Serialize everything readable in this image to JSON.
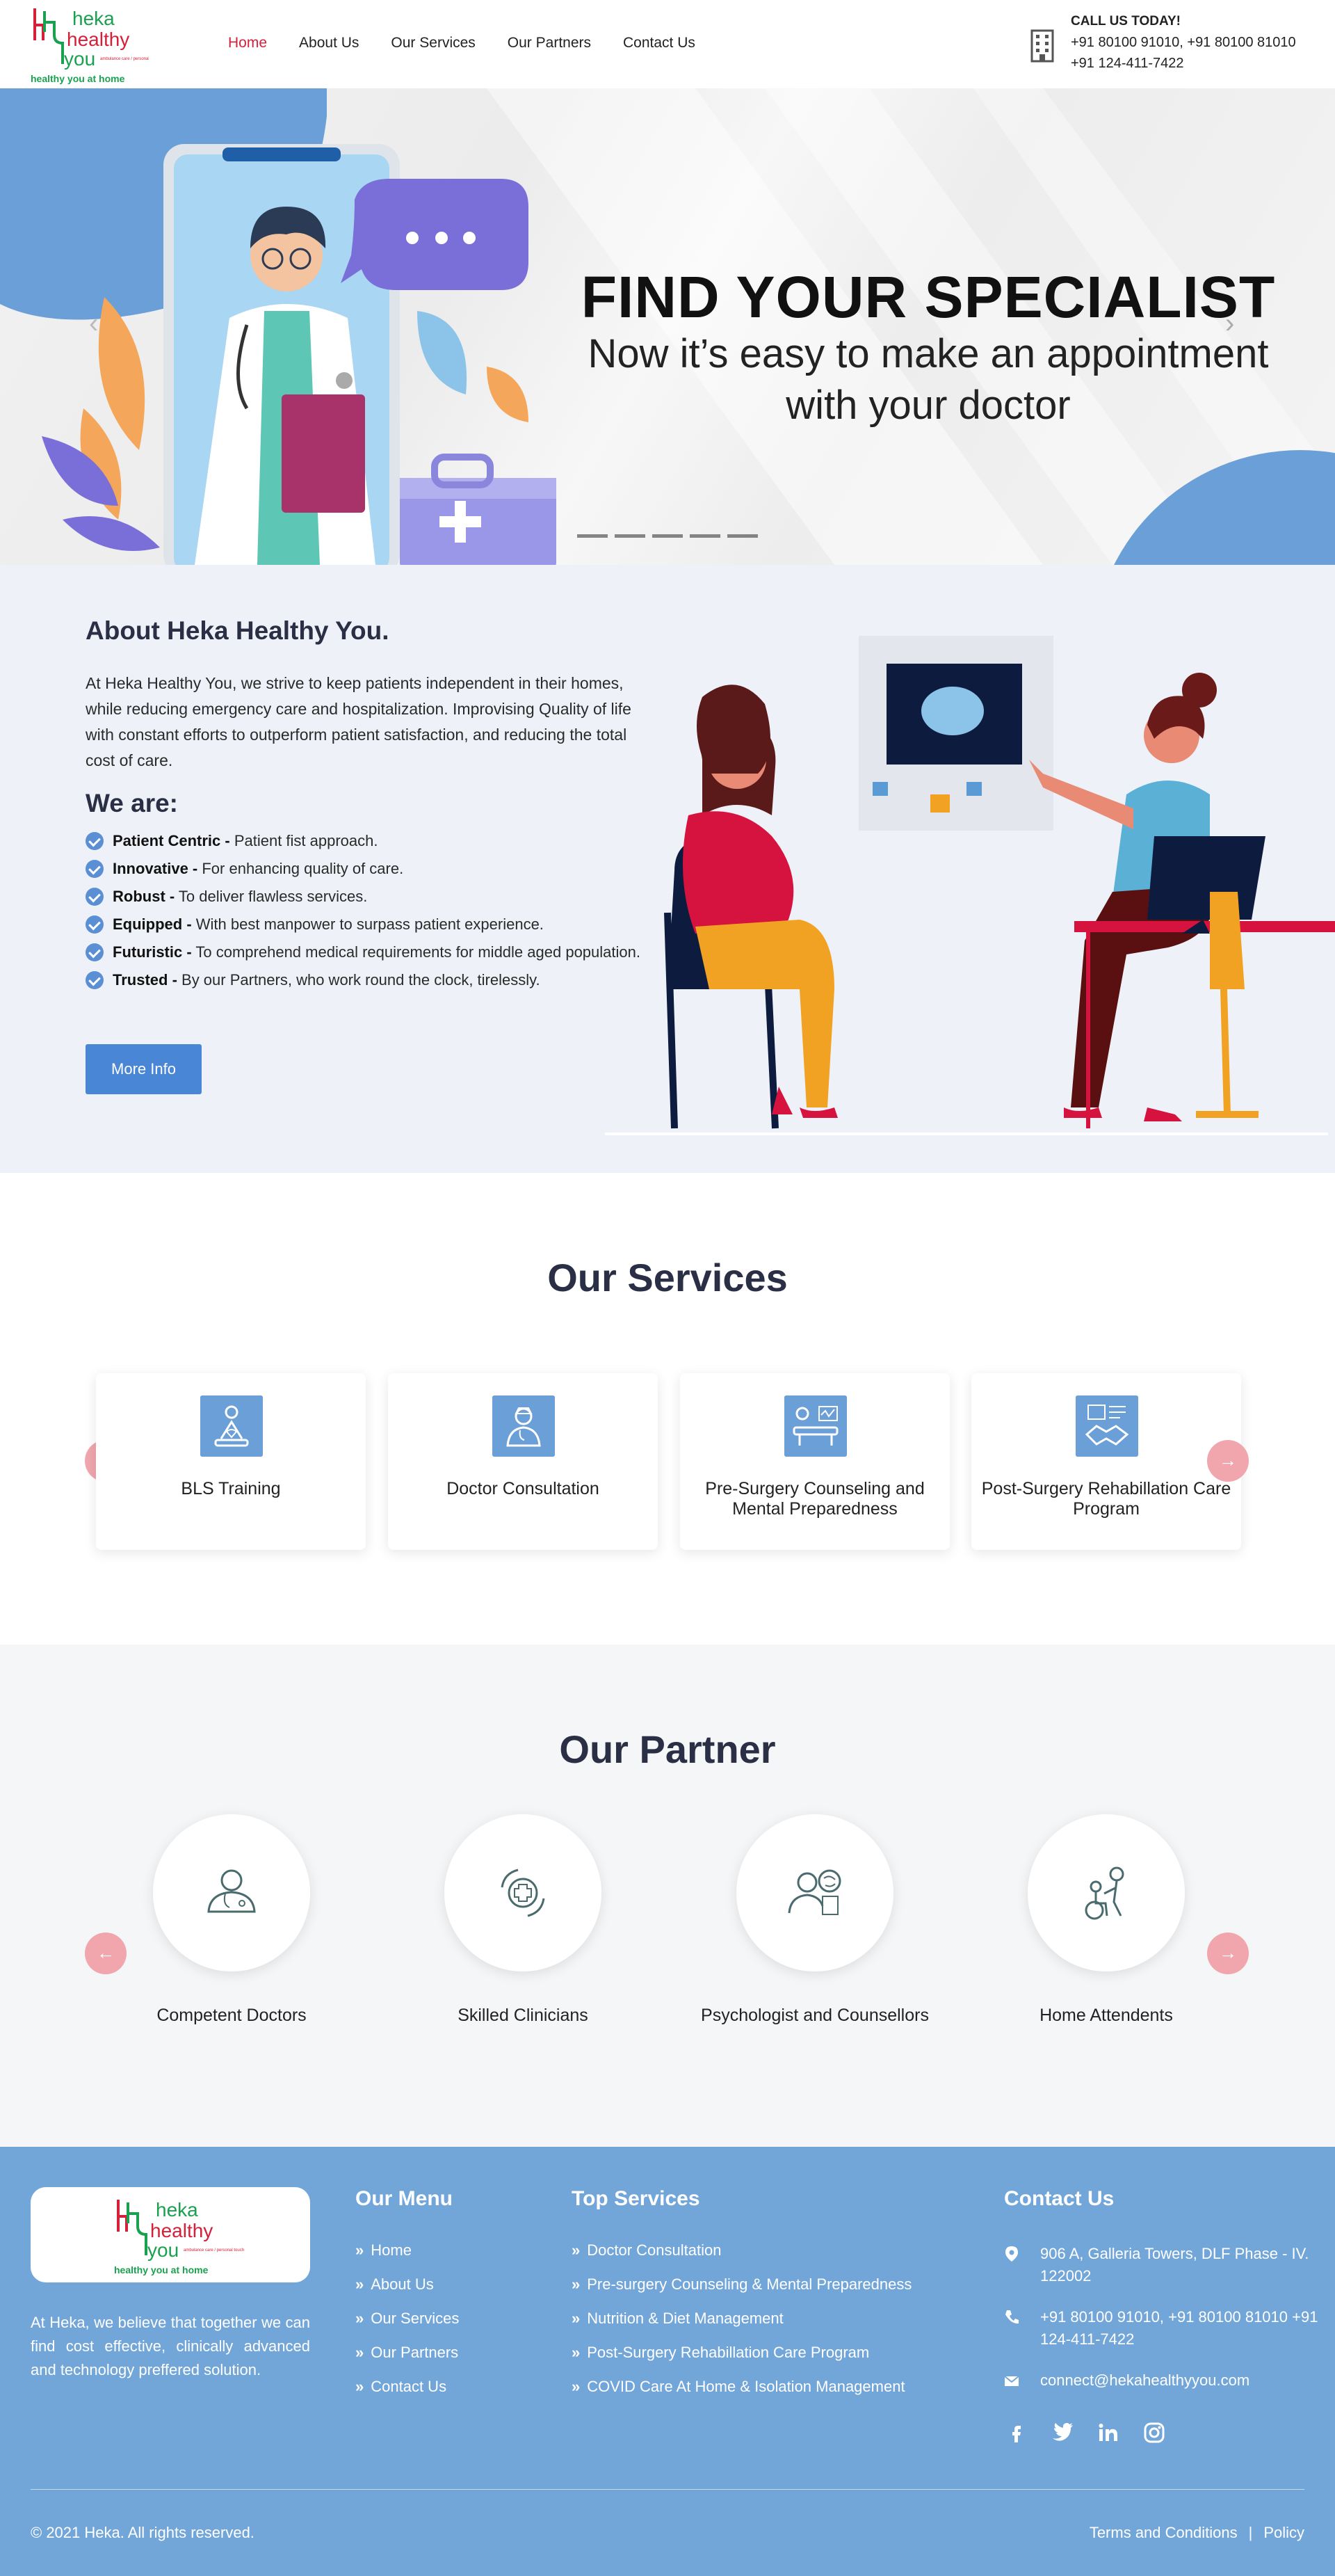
{
  "header": {
    "logo_words": [
      "heka",
      "healthy",
      "you"
    ],
    "logo_tagline": "healthy you at home",
    "logo_small": "ambulance care / personal touch",
    "nav": [
      {
        "label": "Home",
        "active": true
      },
      {
        "label": "About Us",
        "active": false
      },
      {
        "label": "Our Services",
        "active": false
      },
      {
        "label": "Our Partners",
        "active": false
      },
      {
        "label": "Contact Us",
        "active": false
      }
    ],
    "call_title": "CALL US TODAY!",
    "call_phones": "+91 80100 91010, +91 80100 81010",
    "call_phone2": "+91 124-411-7422",
    "call_icon": "building-icon"
  },
  "hero": {
    "title": "FIND YOUR SPECIALIST",
    "subtitle_line1": "Now it’s easy to make an appointment",
    "subtitle_line2": "with your doctor",
    "slide_count": 5,
    "prev_icon": "‹",
    "next_icon": "›"
  },
  "about": {
    "title": "About Heka Healthy You.",
    "text": "At Heka Healthy You, we strive to keep patients independent in their homes, while reducing emergency care and hospitalization. Improvising Quality of life with constant efforts to outperform patient satisfaction, and reducing the total cost of care.",
    "we_are": "We are:",
    "features": [
      {
        "term": "Patient Centric -",
        "desc": " Patient fist approach."
      },
      {
        "term": "Innovative -",
        "desc": " For enhancing quality of care."
      },
      {
        "term": "Robust -",
        "desc": " To deliver flawless services."
      },
      {
        "term": "Equipped -",
        "desc": " With best manpower to surpass patient experience."
      },
      {
        "term": "Futuristic -",
        "desc": " To comprehend medical requirements for middle aged population."
      },
      {
        "term": "Trusted -",
        "desc": " By our Partners, who work round the clock, tirelessly."
      }
    ],
    "button": "More Info"
  },
  "services": {
    "title": "Our Services",
    "items": [
      {
        "label": "BLS Training",
        "icon": "cpr-training-icon"
      },
      {
        "label": "Doctor Consultation",
        "icon": "doctor-icon"
      },
      {
        "label": "Pre-Surgery Counseling and Mental Preparedness",
        "icon": "surgery-bed-icon"
      },
      {
        "label": "Post-Surgery Rehabillation Care Program",
        "icon": "rehab-handshake-icon"
      }
    ],
    "prev_arrow": "←",
    "next_arrow": "→"
  },
  "partners": {
    "title": "Our Partner",
    "items": [
      {
        "label": "Competent Doctors",
        "icon": "doctor-stethoscope-icon"
      },
      {
        "label": "Skilled Clinicians",
        "icon": "medical-cross-icon"
      },
      {
        "label": "Psychologist and Counsellors",
        "icon": "psychologist-brain-icon"
      },
      {
        "label": "Home Attendents",
        "icon": "wheelchair-attendant-icon"
      }
    ],
    "prev_arrow": "←",
    "next_arrow": "→"
  },
  "footer": {
    "about": "At Heka, we believe that together we can find cost effective, clinically advanced and technology preffered solution.",
    "menu_title": "Our Menu",
    "menu": [
      "Home",
      "About Us",
      "Our Services",
      "Our Partners",
      "Contact Us"
    ],
    "services_title": "Top Services",
    "services": [
      "Doctor Consultation",
      "Pre-surgery Counseling & Mental Preparedness",
      "Nutrition & Diet Management",
      "Post-Surgery Rehabillation Care Program",
      "COVID Care At Home & Isolation Management"
    ],
    "contact_title": "Contact Us",
    "address": "906 A, Galleria Towers, DLF Phase - IV. 122002",
    "phones": "+91 80100 91010, +91 80100 81010 +91 124-411-7422",
    "email": "connect@hekahealthyyou.com",
    "social": [
      "facebook-icon",
      "twitter-icon",
      "linkedin-icon",
      "instagram-icon"
    ],
    "copyright": "© 2021 Heka. All rights reserved.",
    "terms": "Terms and Conditions",
    "separator": "|",
    "policy": "Policy"
  },
  "colors": {
    "brand_green": "#1aa150",
    "brand_red": "#d6203a",
    "accent_blue": "#4a86d6",
    "footer_bg": "#72a6d9",
    "carousel_btn": "#f1a6ae"
  }
}
